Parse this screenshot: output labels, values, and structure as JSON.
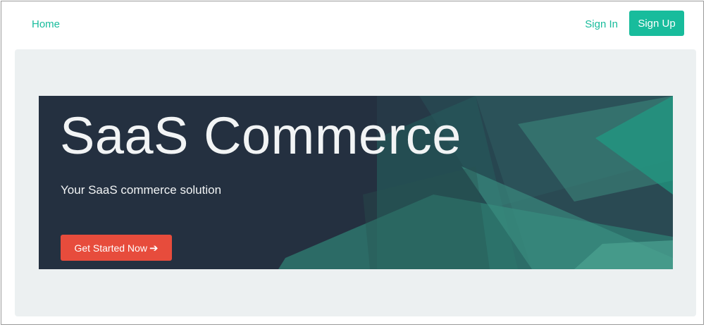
{
  "nav": {
    "home_label": "Home",
    "signin_label": "Sign In",
    "signup_label": "Sign Up"
  },
  "hero": {
    "title": "SaaS Commerce",
    "subtitle": "Your SaaS commerce solution",
    "cta_label": "Get Started Now",
    "cta_icon": "arrow-right-icon"
  },
  "colors": {
    "accent": "#18bc9c",
    "cta": "#e74c3c",
    "hero_bg": "#243040",
    "jumbotron_bg": "#ecf0f1"
  }
}
